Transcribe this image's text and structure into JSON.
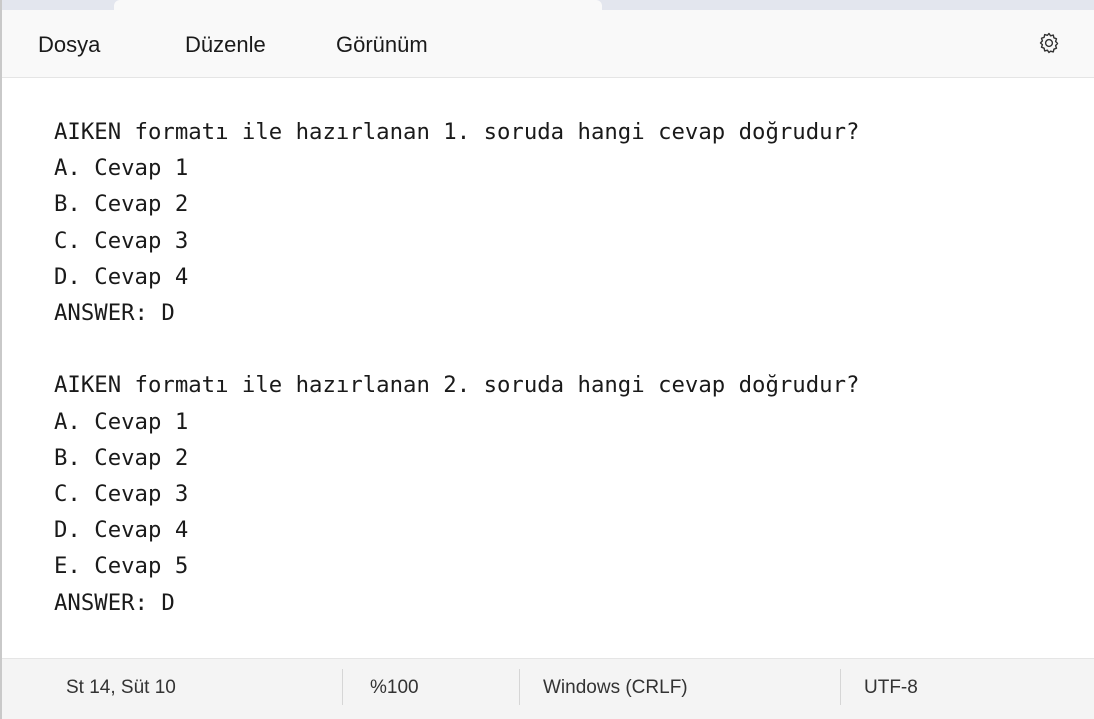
{
  "menu": {
    "file": "Dosya",
    "edit": "Düzenle",
    "view": "Görünüm"
  },
  "settings_icon": "gear-icon",
  "document": {
    "lines": [
      "AIKEN formatı ile hazırlanan 1. soruda hangi cevap doğrudur?",
      "A. Cevap 1",
      "B. Cevap 2",
      "C. Cevap 3",
      "D. Cevap 4",
      "ANSWER: D",
      "",
      "AIKEN formatı ile hazırlanan 2. soruda hangi cevap doğrudur?",
      "A. Cevap 1",
      "B. Cevap 2",
      "C. Cevap 3",
      "D. Cevap 4",
      "E. Cevap 5",
      "ANSWER: D"
    ]
  },
  "status": {
    "position": "St 14, Süt 10",
    "zoom": "%100",
    "line_ending": "Windows (CRLF)",
    "encoding": "UTF-8"
  }
}
